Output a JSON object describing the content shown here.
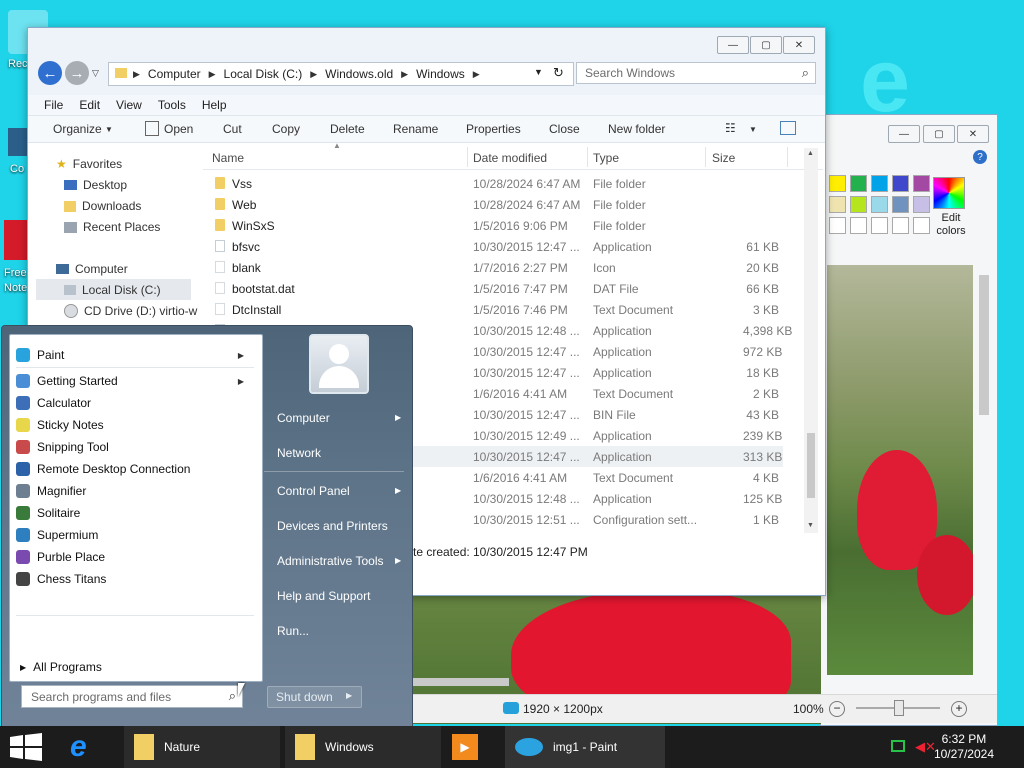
{
  "desktop": {
    "icons": [
      "Rec",
      "Co",
      "Free",
      "Note"
    ]
  },
  "explorer": {
    "breadcrumb": [
      "Computer",
      "Local Disk (C:)",
      "Windows.old",
      "Windows"
    ],
    "search_placeholder": "Search Windows",
    "menu": [
      "File",
      "Edit",
      "View",
      "Tools",
      "Help"
    ],
    "toolbar": [
      "Organize",
      "Open",
      "Cut",
      "Copy",
      "Delete",
      "Rename",
      "Properties",
      "Close",
      "New folder"
    ],
    "nav": {
      "favorites": "Favorites",
      "desktop": "Desktop",
      "downloads": "Downloads",
      "recent": "Recent Places",
      "computer": "Computer",
      "local_disk": "Local Disk (C:)",
      "cd_drive": "CD Drive (D:) virtio-w"
    },
    "columns": [
      "Name",
      "Date modified",
      "Type",
      "Size"
    ],
    "files": [
      {
        "name": "Vss",
        "date": "10/28/2024 6:47 AM",
        "type": "File folder",
        "size": "",
        "kind": "folder"
      },
      {
        "name": "Web",
        "date": "10/28/2024 6:47 AM",
        "type": "File folder",
        "size": "",
        "kind": "folder"
      },
      {
        "name": "WinSxS",
        "date": "1/5/2016 9:06 PM",
        "type": "File folder",
        "size": "",
        "kind": "folder"
      },
      {
        "name": "bfsvc",
        "date": "10/30/2015 12:47 ...",
        "type": "Application",
        "size": "61 KB",
        "kind": "app"
      },
      {
        "name": "blank",
        "date": "1/7/2016 2:27 PM",
        "type": "Icon",
        "size": "20 KB",
        "kind": "file"
      },
      {
        "name": "bootstat.dat",
        "date": "1/5/2016 7:47 PM",
        "type": "DAT File",
        "size": "66 KB",
        "kind": "file"
      },
      {
        "name": "DtcInstall",
        "date": "1/5/2016 7:46 PM",
        "type": "Text Document",
        "size": "3 KB",
        "kind": "file"
      },
      {
        "name": "",
        "date": "10/30/2015 12:48 ...",
        "type": "Application",
        "size": "4,398 KB",
        "kind": "app"
      },
      {
        "name": "",
        "date": "10/30/2015 12:47 ...",
        "type": "Application",
        "size": "972 KB",
        "kind": "app"
      },
      {
        "name": "",
        "date": "10/30/2015 12:47 ...",
        "type": "Application",
        "size": "18 KB",
        "kind": "app"
      },
      {
        "name": "",
        "date": "1/6/2016 4:41 AM",
        "type": "Text Document",
        "size": "2 KB",
        "kind": "file"
      },
      {
        "name": "",
        "date": "10/30/2015 12:47 ...",
        "type": "BIN File",
        "size": "43 KB",
        "kind": "file"
      },
      {
        "name": "",
        "date": "10/30/2015 12:49 ...",
        "type": "Application",
        "size": "239 KB",
        "kind": "app"
      },
      {
        "name": "",
        "date": "10/30/2015 12:47 ...",
        "type": "Application",
        "size": "313 KB",
        "kind": "app"
      },
      {
        "name": "",
        "date": "1/6/2016 4:41 AM",
        "type": "Text Document",
        "size": "4 KB",
        "kind": "file"
      },
      {
        "name": "",
        "date": "10/30/2015 12:48 ...",
        "type": "Application",
        "size": "125 KB",
        "kind": "app"
      },
      {
        "name": "",
        "date": "10/30/2015 12:51 ...",
        "type": "Configuration sett...",
        "size": "1 KB",
        "kind": "file"
      }
    ],
    "details_label": "te created:",
    "details_value": "10/30/2015 12:47 PM"
  },
  "paint": {
    "edit_colors": "Edit colors",
    "image_size": "1920 × 1200px",
    "zoom": "100%",
    "zoom_level": 0.5
  },
  "startmenu": {
    "programs": [
      {
        "label": "Paint",
        "arrow": true
      },
      {
        "label": "Getting Started",
        "arrow": true
      },
      {
        "label": "Calculator",
        "arrow": false
      },
      {
        "label": "Sticky Notes",
        "arrow": false
      },
      {
        "label": "Snipping Tool",
        "arrow": false
      },
      {
        "label": "Remote Desktop Connection",
        "arrow": false
      },
      {
        "label": "Magnifier",
        "arrow": false
      },
      {
        "label": "Solitaire",
        "arrow": false
      },
      {
        "label": "Supermium",
        "arrow": false
      },
      {
        "label": "Purble Place",
        "arrow": false
      },
      {
        "label": "Chess Titans",
        "arrow": false
      }
    ],
    "all_programs": "All Programs",
    "search_placeholder": "Search programs and files",
    "right": [
      "Computer",
      "Network",
      "Control Panel",
      "Devices and Printers",
      "Administrative Tools",
      "Help and Support",
      "Run..."
    ],
    "shutdown": "Shut down"
  },
  "taskbar": {
    "items": [
      "Nature",
      "Windows",
      "img1 - Paint"
    ],
    "time": "6:32 PM",
    "date": "10/27/2024"
  },
  "colors": {
    "desktop": "#1fd3e8",
    "taskbar": "#1c1c1c",
    "start_panel": "#5e7488"
  }
}
